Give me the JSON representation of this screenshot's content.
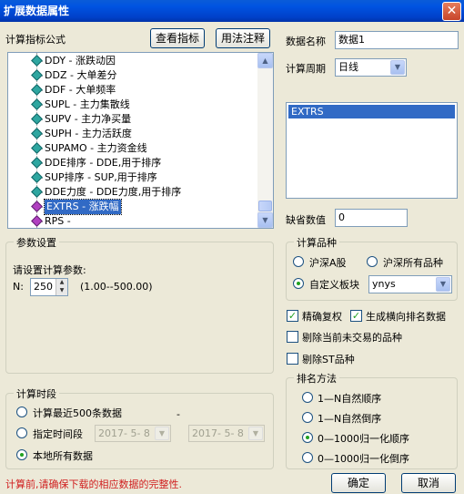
{
  "window": {
    "title": "扩展数据属性",
    "close_glyph": "✕"
  },
  "formula": {
    "label": "计算指标公式",
    "view_button": "查看指标",
    "usage_button": "用法注释",
    "items": [
      {
        "text": "DDY - 涨跌动因",
        "color": "teal",
        "selected": false
      },
      {
        "text": "DDZ - 大单差分",
        "color": "teal",
        "selected": false
      },
      {
        "text": "DDF - 大单频率",
        "color": "teal",
        "selected": false
      },
      {
        "text": "SUPL - 主力集散线",
        "color": "teal",
        "selected": false
      },
      {
        "text": "SUPV - 主力净买量",
        "color": "teal",
        "selected": false
      },
      {
        "text": "SUPH - 主力活跃度",
        "color": "teal",
        "selected": false
      },
      {
        "text": "SUPAMO - 主力资金线",
        "color": "teal",
        "selected": false
      },
      {
        "text": "DDE排序 - DDE,用于排序",
        "color": "teal",
        "selected": false
      },
      {
        "text": "SUP排序 - SUP,用于排序",
        "color": "teal",
        "selected": false
      },
      {
        "text": "DDE力度 - DDE力度,用于排序",
        "color": "teal",
        "selected": false
      },
      {
        "text": "EXTRS - 涨跌幅",
        "color": "purple",
        "selected": true
      },
      {
        "text": "RPS -",
        "color": "purple",
        "selected": false
      }
    ]
  },
  "params": {
    "group_title": "参数设置",
    "prompt": "请设置计算参数:",
    "n_label": "N:",
    "n_value": "250",
    "range": "(1.00--500.00)"
  },
  "period": {
    "group_title": "计算时段",
    "opt_recent": "计算最近500条数据",
    "opt_range": "指定时间段",
    "opt_all": "本地所有数据",
    "selected": "all",
    "dash": "-",
    "date_from": "2017- 5- 8",
    "date_to": "2017- 5- 8"
  },
  "right": {
    "name_label": "数据名称",
    "name_value": "数据1",
    "cycle_label": "计算周期",
    "cycle_value": "日线",
    "list_selected": "EXTRS",
    "default_label": "缺省数值",
    "default_value": "0"
  },
  "variety": {
    "group_title": "计算品种",
    "opt_hsa": "沪深A股",
    "opt_hsall": "沪深所有品种",
    "opt_custom": "自定义板块",
    "custom_value": "ynys",
    "selected": "custom"
  },
  "checks": {
    "precise": {
      "label": "精确复权",
      "checked": true
    },
    "rank_data": {
      "label": "生成横向排名数据",
      "checked": true
    },
    "exclude_untraded": {
      "label": "剔除当前未交易的品种",
      "checked": false
    },
    "exclude_st": {
      "label": "剔除ST品种",
      "checked": false
    }
  },
  "ranking": {
    "group_title": "排名方法",
    "opt1": "1—N自然顺序",
    "opt2": "1—N自然倒序",
    "opt3": "0—1000归一化顺序",
    "opt4": "0—1000归一化倒序",
    "selected": 3
  },
  "footer": {
    "note": "计算前,请确保下载的相应数据的完整性.",
    "ok": "确定",
    "cancel": "取消"
  },
  "colors": {
    "title_bar": "#0053e1",
    "selection": "#316ac5",
    "warning_text": "#d02020"
  }
}
